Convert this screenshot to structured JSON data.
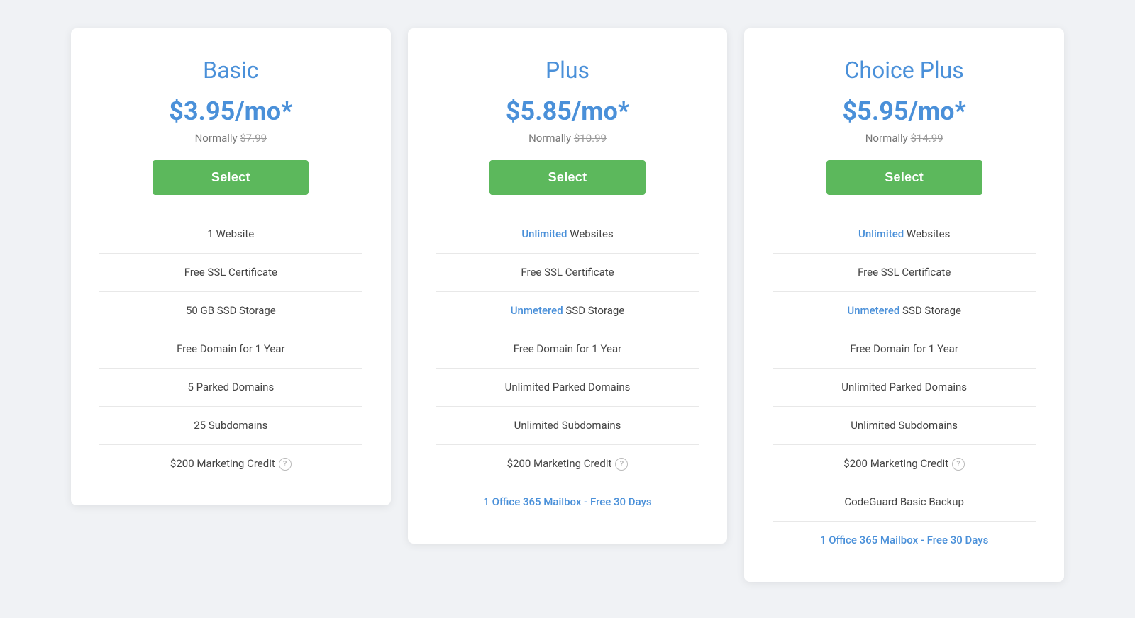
{
  "plans": [
    {
      "id": "basic",
      "name": "Basic",
      "price": "$3.95/mo*",
      "normal_label": "Normally",
      "normal_price": "$7.99",
      "select_label": "Select",
      "features": [
        {
          "text": "1 Website",
          "highlight": null,
          "is_link": false
        },
        {
          "text": "Free SSL Certificate",
          "highlight": null,
          "is_link": false
        },
        {
          "text": "50 GB SSD Storage",
          "highlight": null,
          "is_link": false
        },
        {
          "text": "Free Domain for 1 Year",
          "highlight": null,
          "is_link": false
        },
        {
          "text": "5 Parked Domains",
          "highlight": null,
          "is_link": false
        },
        {
          "text": "25 Subdomains",
          "highlight": null,
          "is_link": false
        },
        {
          "text": "$200 Marketing Credit",
          "highlight": null,
          "has_help": true,
          "is_link": false
        }
      ]
    },
    {
      "id": "plus",
      "name": "Plus",
      "price": "$5.85/mo*",
      "normal_label": "Normally",
      "normal_price": "$10.99",
      "select_label": "Select",
      "features": [
        {
          "text": " Websites",
          "prefix": "Unlimited",
          "highlight": "Unlimited",
          "is_link": false
        },
        {
          "text": "Free SSL Certificate",
          "highlight": null,
          "is_link": false
        },
        {
          "text": " SSD Storage",
          "prefix": "Unmetered",
          "highlight": "Unmetered",
          "is_link": false
        },
        {
          "text": "Free Domain for 1 Year",
          "highlight": null,
          "is_link": false
        },
        {
          "text": "Unlimited Parked Domains",
          "highlight": null,
          "is_link": false
        },
        {
          "text": "Unlimited Subdomains",
          "highlight": null,
          "is_link": false
        },
        {
          "text": "$200 Marketing Credit",
          "highlight": null,
          "has_help": true,
          "is_link": false
        },
        {
          "text": "1 Office 365 Mailbox - Free 30 Days",
          "highlight": null,
          "is_link": true
        }
      ]
    },
    {
      "id": "choice-plus",
      "name": "Choice Plus",
      "price": "$5.95/mo*",
      "normal_label": "Normally",
      "normal_price": "$14.99",
      "select_label": "Select",
      "features": [
        {
          "text": " Websites",
          "prefix": "Unlimited",
          "highlight": "Unlimited",
          "is_link": false
        },
        {
          "text": "Free SSL Certificate",
          "highlight": null,
          "is_link": false
        },
        {
          "text": " SSD Storage",
          "prefix": "Unmetered",
          "highlight": "Unmetered",
          "is_link": false
        },
        {
          "text": "Free Domain for 1 Year",
          "highlight": null,
          "is_link": false
        },
        {
          "text": "Unlimited Parked Domains",
          "highlight": null,
          "is_link": false
        },
        {
          "text": "Unlimited Subdomains",
          "highlight": null,
          "is_link": false
        },
        {
          "text": "$200 Marketing Credit",
          "highlight": null,
          "has_help": true,
          "is_link": false
        },
        {
          "text": "CodeGuard Basic Backup",
          "highlight": null,
          "is_link": false
        },
        {
          "text": "1 Office 365 Mailbox - Free 30 Days",
          "highlight": null,
          "is_link": true
        }
      ]
    }
  ],
  "colors": {
    "accent": "#4a90d9",
    "green": "#5cb85c",
    "text_normal": "#777",
    "text_dark": "#444"
  }
}
